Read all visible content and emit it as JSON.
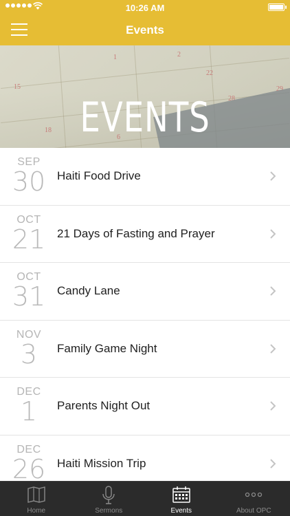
{
  "status_bar": {
    "time": "10:26 AM"
  },
  "nav": {
    "title": "Events"
  },
  "hero": {
    "title": "EVENTS",
    "calendar_numbers": [
      "1",
      "2",
      "15",
      "22",
      "28",
      "29",
      "18",
      "6"
    ]
  },
  "events": [
    {
      "month": "SEP",
      "day": "30",
      "name": "Haiti Food Drive"
    },
    {
      "month": "OCT",
      "day": "21",
      "name": "21 Days of Fasting and Prayer"
    },
    {
      "month": "OCT",
      "day": "31",
      "name": "Candy Lane"
    },
    {
      "month": "NOV",
      "day": "3",
      "name": "Family Game Night"
    },
    {
      "month": "DEC",
      "day": "1",
      "name": "Parents Night Out"
    },
    {
      "month": "DEC",
      "day": "26",
      "name": "Haiti Mission Trip"
    }
  ],
  "tabs": [
    {
      "label": "Home",
      "icon": "book-map-icon",
      "active": false
    },
    {
      "label": "Sermons",
      "icon": "microphone-icon",
      "active": false
    },
    {
      "label": "Events",
      "icon": "calendar-icon",
      "active": true
    },
    {
      "label": "About OPC",
      "icon": "more-dots-icon",
      "active": false
    }
  ],
  "colors": {
    "brand": "#e6bd34",
    "tab_bar_bg": "#2b2b2b",
    "date_text": "#b5b5b5"
  }
}
